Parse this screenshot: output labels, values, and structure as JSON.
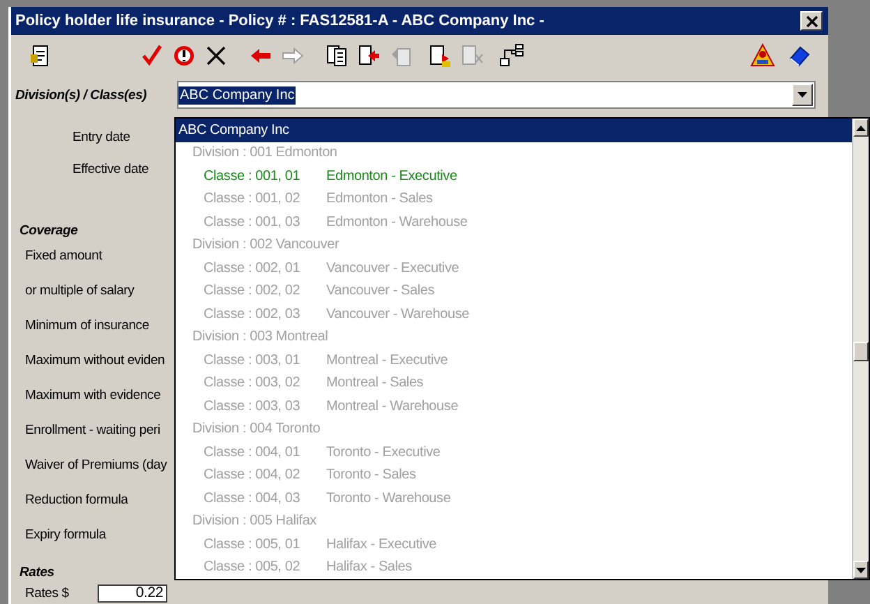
{
  "window": {
    "title": "Policy holder life insurance - Policy # : FAS12581-A - ABC Company Inc -"
  },
  "division_field": {
    "label": "Division(s) / Class(es)",
    "value": "ABC Company Inc"
  },
  "form": [
    {
      "kind": "indented",
      "label": "Entry date"
    },
    {
      "kind": "indented",
      "label": "Effective date"
    },
    {
      "kind": "section",
      "label": "Coverage"
    },
    {
      "kind": "label",
      "label": "Fixed amount"
    },
    {
      "kind": "label",
      "label": "or multiple of salary"
    },
    {
      "kind": "label",
      "label": "Minimum of insurance"
    },
    {
      "kind": "label",
      "label": "Maximum without eviden"
    },
    {
      "kind": "label",
      "label": "Maximum with evidence"
    },
    {
      "kind": "label",
      "label": "Enrollment - waiting peri"
    },
    {
      "kind": "label",
      "label": "Waiver of Premiums (day"
    },
    {
      "kind": "label",
      "label": "Reduction formula"
    },
    {
      "kind": "label",
      "label": "Expiry formula"
    },
    {
      "kind": "section",
      "label": "Rates"
    },
    {
      "kind": "input",
      "label": "Rates $",
      "value": "0.22"
    }
  ],
  "dropdown": {
    "items": [
      {
        "kind": "company",
        "label": "ABC Company Inc",
        "selected": true,
        "current": false
      },
      {
        "kind": "division",
        "label": "Division : 001 Edmonton",
        "selected": false,
        "current": false
      },
      {
        "kind": "class",
        "code": "Classe : 001, 01",
        "label": "Edmonton - Executive",
        "selected": false,
        "current": true
      },
      {
        "kind": "class",
        "code": "Classe : 001, 02",
        "label": "Edmonton - Sales",
        "selected": false,
        "current": false
      },
      {
        "kind": "class",
        "code": "Classe : 001, 03",
        "label": "Edmonton - Warehouse",
        "selected": false,
        "current": false
      },
      {
        "kind": "division",
        "label": "Division : 002 Vancouver",
        "selected": false,
        "current": false
      },
      {
        "kind": "class",
        "code": "Classe : 002, 01",
        "label": "Vancouver - Executive",
        "selected": false,
        "current": false
      },
      {
        "kind": "class",
        "code": "Classe : 002, 02",
        "label": "Vancouver - Sales",
        "selected": false,
        "current": false
      },
      {
        "kind": "class",
        "code": "Classe : 002, 03",
        "label": "Vancouver - Warehouse",
        "selected": false,
        "current": false
      },
      {
        "kind": "division",
        "label": "Division : 003 Montreal",
        "selected": false,
        "current": false
      },
      {
        "kind": "class",
        "code": "Classe : 003, 01",
        "label": "Montreal - Executive",
        "selected": false,
        "current": false
      },
      {
        "kind": "class",
        "code": "Classe : 003, 02",
        "label": "Montreal - Sales",
        "selected": false,
        "current": false
      },
      {
        "kind": "class",
        "code": "Classe : 003, 03",
        "label": "Montreal - Warehouse",
        "selected": false,
        "current": false
      },
      {
        "kind": "division",
        "label": "Division : 004 Toronto",
        "selected": false,
        "current": false
      },
      {
        "kind": "class",
        "code": "Classe : 004, 01",
        "label": "Toronto - Executive",
        "selected": false,
        "current": false
      },
      {
        "kind": "class",
        "code": "Classe : 004, 02",
        "label": "Toronto - Sales",
        "selected": false,
        "current": false
      },
      {
        "kind": "class",
        "code": "Classe : 004, 03",
        "label": "Toronto - Warehouse",
        "selected": false,
        "current": false
      },
      {
        "kind": "division",
        "label": "Division : 005 Halifax",
        "selected": false,
        "current": false
      },
      {
        "kind": "class",
        "code": "Classe : 005, 01",
        "label": "Halifax - Executive",
        "selected": false,
        "current": false
      },
      {
        "kind": "class",
        "code": "Classe : 005, 02",
        "label": "Halifax - Sales",
        "selected": false,
        "current": false
      }
    ]
  }
}
